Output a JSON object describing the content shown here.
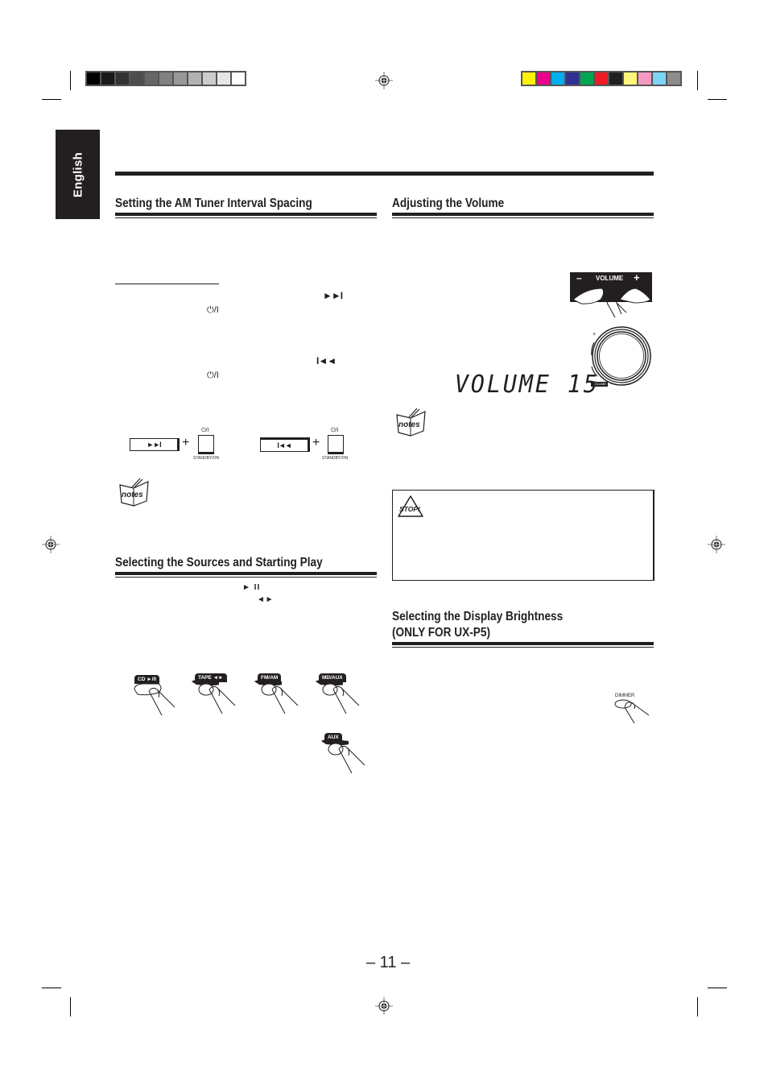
{
  "print_marks": {
    "grayscale_swatches": [
      "#000000",
      "#1a1a1a",
      "#333333",
      "#4d4d4d",
      "#666666",
      "#808080",
      "#999999",
      "#b3b3b3",
      "#cccccc",
      "#e6e6e6",
      "#ffffff"
    ],
    "color_swatches": [
      "#fff200",
      "#ec008c",
      "#00aeef",
      "#2e3192",
      "#00a651",
      "#ed1c24",
      "#231f20",
      "#fff57a",
      "#f49ac1",
      "#7dd4f7",
      "#8c8c8c"
    ]
  },
  "language_tab": {
    "label": "English"
  },
  "sections": {
    "am_tuner": {
      "title": "Setting the AM Tuner Interval Spacing",
      "glyphs": {
        "next": "►►I",
        "prev": "I◄◄",
        "power": "⏻/I"
      },
      "diagram": {
        "left_button": "►►I",
        "right_button": "I◄◄",
        "plus": "+",
        "standby_label": "STANDBY/ON",
        "power_label": "⏻/I"
      },
      "notes_icon_label": "notes"
    },
    "sources": {
      "title": "Selecting the Sources and Starting Play",
      "glyphs": {
        "play_pause": "► II",
        "tape_dir": "◄ ►"
      },
      "buttons": [
        "CD ►/II",
        "TAPE ◄►",
        "FM/AM",
        "MD/AUX",
        "AUX"
      ]
    },
    "volume": {
      "title": "Adjusting the Volume",
      "panel_label": "VOLUME",
      "minus": "–",
      "plus": "+",
      "display_text": "VOLUME 15",
      "knob_label": "VOLUME",
      "notes_icon_label": "notes",
      "stop_icon_label": "STOP!"
    },
    "brightness": {
      "title_line1": "Selecting the Display Brightness",
      "title_line2": "(ONLY FOR UX-P5)",
      "button_label": "DIMMER"
    }
  },
  "footer": {
    "page_number": "– 11 –"
  }
}
